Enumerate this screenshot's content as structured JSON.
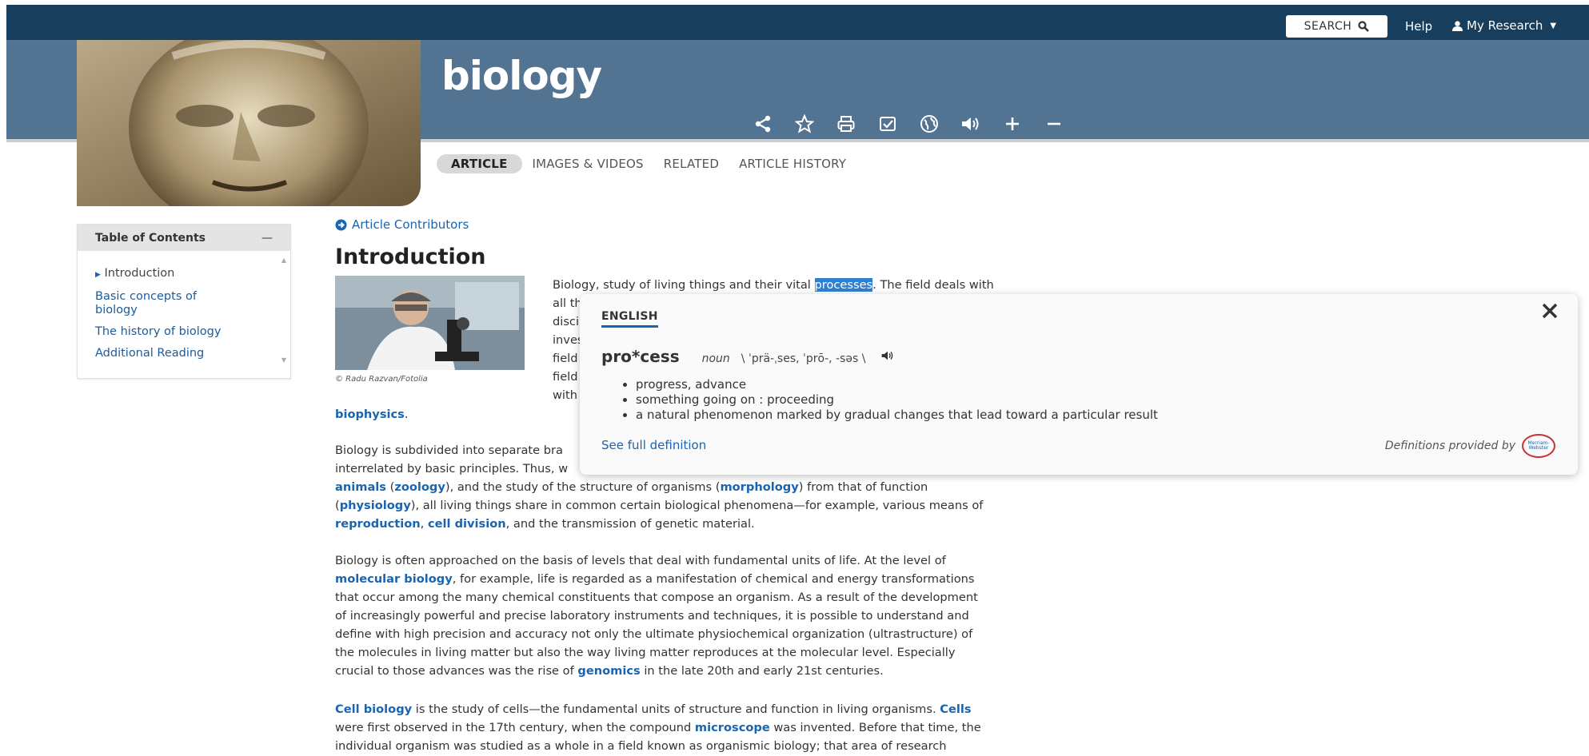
{
  "topbar": {
    "search_label": "SEARCH",
    "help_label": "Help",
    "my_research_label": "My Research"
  },
  "article": {
    "title": "biology",
    "tabs": [
      {
        "label": "ARTICLE",
        "active": true
      },
      {
        "label": "IMAGES & VIDEOS",
        "active": false
      },
      {
        "label": "RELATED",
        "active": false
      },
      {
        "label": "ARTICLE HISTORY",
        "active": false
      }
    ],
    "toolbar_icons": [
      "share-icon",
      "star-icon",
      "print-icon",
      "cite-icon",
      "globe-icon",
      "audio-icon",
      "zoom-in-icon",
      "zoom-out-icon"
    ],
    "contributors_label": "Article Contributors",
    "section_heading": "Introduction",
    "photo_credit": "© Radu Razvan/Fotolia"
  },
  "toc": {
    "title": "Table of Contents",
    "collapse_symbol": "—",
    "items": [
      {
        "label": "Introduction",
        "current": true
      },
      {
        "label": "Basic concepts of biology",
        "current": false
      },
      {
        "label": "The history of biology",
        "current": false
      },
      {
        "label": "Additional Reading",
        "current": false
      }
    ]
  },
  "paragraphs": {
    "p1_lines": [
      "Biology, study of living things and their vital ",
      "processes",
      ". The field deals with",
      "all th",
      "disci",
      "inves",
      "field",
      "field",
      "with"
    ],
    "p1_end": "biophysics",
    "p1_end_punct": ".",
    "p2_line1": "Biology is subdivided into separate bra",
    "p2_line2": "interrelated by basic principles. Thus, w",
    "p2_l3_link1": "animals",
    "p2_l3_link2": "zoology",
    "p2_l3_text": "), and the study of the structure of organisms (",
    "p2_l3_link3": "morphology",
    "p2_l3_text2": ") from that of function",
    "p2_l4_link": "physiology",
    "p2_l4_text": "), all living things share in common certain biological phenomena—for example, various means of",
    "p2_l5_link1": "reproduction",
    "p2_l5_link2": "cell division",
    "p2_l5_text": ", and the transmission of genetic material.",
    "p3_l1": "Biology is often approached on the basis of levels that deal with fundamental units of life. At the level of",
    "p3_l2_link": "molecular biology",
    "p3_l2_text": ", for example, life is regarded as a manifestation of chemical and energy transformations",
    "p3_l3": "that occur among the many chemical constituents that compose an organism. As a result of the development",
    "p3_l4": "of increasingly powerful and precise laboratory instruments and techniques, it is possible to understand and",
    "p3_l5": "define with high precision and accuracy not only the ultimate physiochemical organization (ultrastructure) of",
    "p3_l6": "the molecules in living matter but also the way living matter reproduces at the molecular level. Especially",
    "p3_l7_text": "crucial to those advances was the rise of ",
    "p3_l7_link": "genomics",
    "p3_l7_text2": " in the late 20th and early 21st centuries.",
    "p4_l1_link": "Cell biology",
    "p4_l1_text": " is the study of cells—the fundamental units of structure and function in living organisms. ",
    "p4_l1_link2": "Cells",
    "p4_l2_text": "were first observed in the 17th century, when the compound ",
    "p4_l2_link": "microscope",
    "p4_l2_text2": " was invented. Before that time, the",
    "p4_l3": "individual organism was studied as a whole in a field known as organismic biology; that area of research"
  },
  "popup": {
    "language_tab": "ENGLISH",
    "headword": "pro*cess",
    "part_of_speech": "noun",
    "pronunciation": "\\ ˈprä-ˌses, ˈprō-, -səs \\",
    "definitions": [
      "progress, advance",
      "something going on : proceeding",
      "a natural phenomenon marked by gradual changes that lead toward a particular result"
    ],
    "see_full_label": "See full definition",
    "provided_by_label": "Definitions provided by",
    "logo_text": "Merriam-Webster"
  }
}
